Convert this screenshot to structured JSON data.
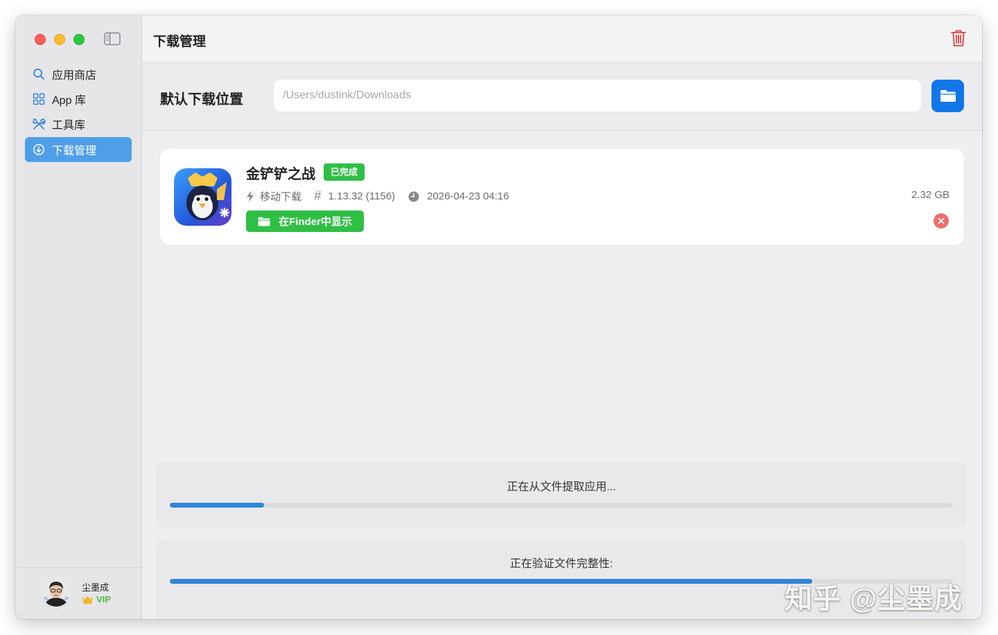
{
  "sidebar": {
    "items": [
      {
        "label": "应用商店",
        "icon": "search-icon"
      },
      {
        "label": "App 库",
        "icon": "grid-icon"
      },
      {
        "label": "工具库",
        "icon": "tools-icon"
      },
      {
        "label": "下载管理",
        "icon": "download-icon",
        "active": true
      }
    ],
    "user": {
      "name": "尘墨成",
      "badge": "VIP"
    }
  },
  "header": {
    "title": "下载管理"
  },
  "location": {
    "label": "默认下载位置",
    "placeholder": "/Users/dustink/Downloads"
  },
  "download": {
    "app_name": "金铲铲之战",
    "status": "已完成",
    "source": "移动下载",
    "version": "1.13.32 (1156)",
    "date": "2026-04-23 04:16",
    "size": "2.32 GB",
    "finder_label": "在Finder中显示"
  },
  "progress": [
    {
      "text": "正在从文件提取应用...",
      "value": 0.12
    },
    {
      "text": "正在验证文件完整性:",
      "value": 0.82
    }
  ],
  "watermark": "知乎 @尘墨成",
  "colors": {
    "accent": "#4f9ee8",
    "success": "#2fbf45",
    "danger": "#e0443e",
    "progress": "#2f86d8"
  }
}
